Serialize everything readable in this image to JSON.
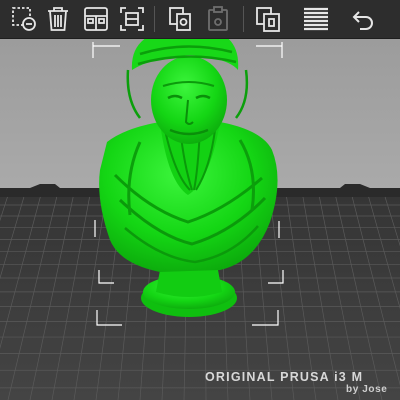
{
  "toolbar": {
    "buttons": [
      {
        "name": "add-icon",
        "state": "enabled"
      },
      {
        "name": "delete-icon",
        "state": "enabled"
      },
      {
        "name": "arrange-icon",
        "state": "enabled"
      },
      {
        "name": "select-all-icon",
        "state": "enabled"
      },
      {
        "name": "copy-icon",
        "state": "enabled"
      },
      {
        "name": "paste-icon",
        "state": "disabled"
      },
      {
        "name": "instances-icon",
        "state": "enabled"
      },
      {
        "name": "layers-icon",
        "state": "enabled"
      },
      {
        "name": "undo-icon",
        "state": "enabled"
      }
    ],
    "icon_color": "#e6e6e6",
    "background": "#2d2d2d"
  },
  "scene": {
    "background_color": "#a9a9a9",
    "bed_color": "#3b3b3b",
    "grid_color": "#5a5a5a",
    "model_color": "#12dc12",
    "model_name": "bust",
    "bed_label_line1": "ORIGINAL PRUSA i3 M",
    "bed_label_line2": "by Jose"
  }
}
